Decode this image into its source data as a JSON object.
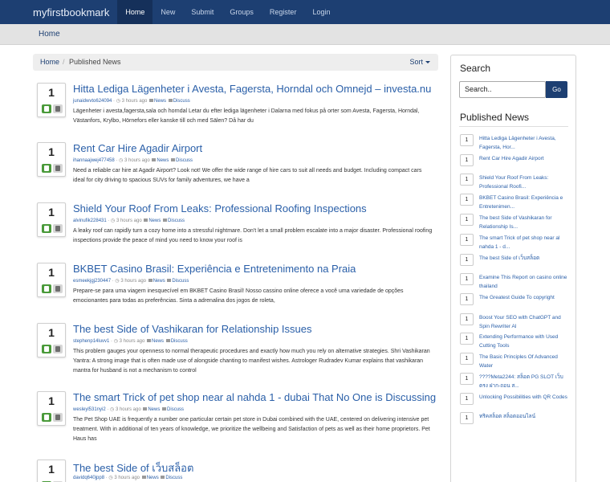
{
  "nav": {
    "brand": "myfirstbookmark",
    "items": [
      "Home",
      "New",
      "Submit",
      "Groups",
      "Register",
      "Login"
    ]
  },
  "subheader": {
    "title": "Home"
  },
  "breadcrumb": {
    "home": "Home",
    "sep": "/",
    "current": "Published News",
    "sort": "Sort"
  },
  "stories": [
    {
      "votes": "1",
      "title": "Hitta Lediga Lägenheter i Avesta, Fagersta, Horndal och Omnejd – investa.nu",
      "user": "junaidwvto624094",
      "time": "3 hours ago",
      "category": "News",
      "discuss": "Discuss",
      "desc": "Lägenheter i avesta,fagersta,sala och horndal Letar du efter lediga lägenheter i Dalarna med fokus på orter som Avesta, Fagersta, Horndal, Västanfors, Krylbo, Hörnefors eller kanske till och med Sälen? Då har du"
    },
    {
      "votes": "1",
      "title": "Rent Car Hire Agadir Airport",
      "user": "ihannaajwej477458",
      "time": "3 hours ago",
      "category": "News",
      "discuss": "Discuss",
      "desc": "Need a reliable car hire at Agadir Airport? Look not! We offer the wide range of hire cars to suit all needs and budget. Including compact cars ideal for city driving to spacious SUVs for family adventures, we have a"
    },
    {
      "votes": "1",
      "title": "Shield Your Roof From Leaks: Professional Roofing Inspections",
      "user": "alvinufik228431",
      "time": "3 hours ago",
      "category": "News",
      "discuss": "Discuss",
      "desc": "A leaky roof can rapidly turn a cozy home into a stressful nightmare. Don't let a small problem escalate into a major disaster. Professional roofing inspections provide the peace of mind you need to know your roof is"
    },
    {
      "votes": "1",
      "title": "BKBET Casino Brasil: Experiência e Entretenimento na Praia",
      "user": "esmeekjgj230447",
      "time": "3 hours ago",
      "category": "News",
      "discuss": "Discuss",
      "desc": "Prepare-se para uma viagem inesquecível em BKBET Casino Brasil! Nosso cassino online oferece a você uma variedade de opções emocionantes para todas as preferências. Sinta a adrenalina dos jogos de roleta,"
    },
    {
      "votes": "1",
      "title": "The best Side of Vashikaran for Relationship Issues",
      "user": "stephenp14luvv1",
      "time": "3 hours ago",
      "category": "News",
      "discuss": "Discuss",
      "desc": "This problem gauges your openness to normal therapeutic procedures and exactly how much you rely on alternative strategies. Shri Vashikaran Yantra: A strong image that is often made use of alongside chanting to manifest wishes. Astrologer Rudradev Kumar explains that vashikaran mantra for husband is not a mechanism to control"
    },
    {
      "votes": "1",
      "title": "The smart Trick of pet shop near al nahda 1 - dubai That No One is Discussing",
      "user": "wesleyl531nyi2",
      "time": "3 hours ago",
      "category": "News",
      "discuss": "Discuss",
      "desc": "The Pet Shop UAE is frequently a number one particular certain pet store in Dubai combined with the UAE, centered on delivering intensive pet treatment. With in additional of ten years of knowledge, we prioritize the wellbeing and Satisfaction of pets as well as their home proprietors. Pet Haus has"
    },
    {
      "votes": "1",
      "title": "The best Side of เว็บสล็อต",
      "user": "davidq640jpp8",
      "time": "3 hours ago",
      "category": "News",
      "discuss": "Discuss",
      "desc": ""
    }
  ],
  "sidebar": {
    "search_title": "Search",
    "search_placeholder": "Search..",
    "go_label": "Go",
    "published_title": "Published News",
    "items": [
      {
        "n": "1",
        "t": "Hitta Lediga Lägenheter i Avesta, Fagersta, Hor..."
      },
      {
        "n": "1",
        "t": "Rent Car Hire Agadir Airport"
      },
      {
        "n": "1",
        "t": "Shield Your Roof From Leaks: Professional Roofi..."
      },
      {
        "n": "1",
        "t": "BKBET Casino Brasil: Experiência e Entretenimen..."
      },
      {
        "n": "1",
        "t": "The best Side of Vashikaran for Relationship Is..."
      },
      {
        "n": "1",
        "t": "The smart Trick of pet shop near al nahda 1 - d..."
      },
      {
        "n": "1",
        "t": "The best Side of เว็บสล็อต"
      },
      {
        "n": "1",
        "t": "Examine This Report on casino online thailand"
      },
      {
        "n": "1",
        "t": "The Greatest Guide To copyright"
      },
      {
        "n": "1",
        "t": "Boost Your SEO with ChatGPT and Spin Rewriter AI"
      },
      {
        "n": "1",
        "t": "Extending Performance with Used Cutting Tools"
      },
      {
        "n": "1",
        "t": "The Basic Principles Of Advanced Water"
      },
      {
        "n": "1",
        "t": "????Meta2244: สล็อต PG SLOT เว็บตรง ฝาก-ถอน ส..."
      },
      {
        "n": "1",
        "t": "Unlocking Possibilities with QR Codes"
      },
      {
        "n": "1",
        "t": "ทริคสล็อต สล็อตออนไลน์"
      }
    ]
  }
}
